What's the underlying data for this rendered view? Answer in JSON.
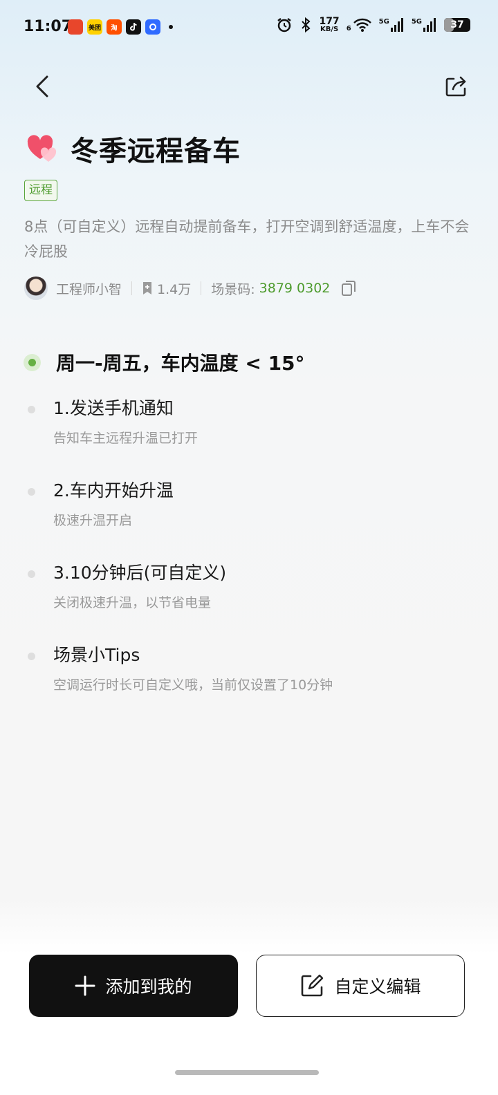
{
  "status_bar": {
    "time": "11:07",
    "app_icons": [
      {
        "name": "app-icon-1",
        "label": "",
        "color": "#e8462b"
      },
      {
        "name": "meituan-icon",
        "label": "美团",
        "color": "#ffd100"
      },
      {
        "name": "taobao-icon",
        "label": "淘",
        "color": "#ff5000"
      },
      {
        "name": "tiktok-icon",
        "label": "",
        "color": "#111111"
      },
      {
        "name": "app-icon-5",
        "label": "",
        "color": "#2f6bff"
      }
    ],
    "net_speed_value": "177",
    "net_speed_unit": "KB/S",
    "signal_1": "5G",
    "signal_2": "5G",
    "wifi_sub": "6",
    "battery": "37",
    "battery_level": 0.37
  },
  "header": {
    "title": "冬季远程备车",
    "tag": "远程",
    "description": "8点（可自定义）远程自动提前备车，打开空调到舒适温度，上车不会冷屁股",
    "author": "工程师小智",
    "saves": "1.4万",
    "code_label": "场景码:",
    "code_value": "3879 0302"
  },
  "trigger": {
    "text": "周一-周五，车内温度 < 15°"
  },
  "steps": [
    {
      "title": "1.发送手机通知",
      "subtitle": "告知车主远程升温已打开"
    },
    {
      "title": "2.车内开始升温",
      "subtitle": "极速升温开启"
    },
    {
      "title": "3.10分钟后(可自定义)",
      "subtitle": "关闭极速升温，以节省电量"
    },
    {
      "title": "场景小Tips",
      "subtitle": "空调运行时长可自定义哦，当前仅设置了10分钟"
    }
  ],
  "actions": {
    "add_label": "添加到我的",
    "edit_label": "自定义编辑"
  },
  "colors": {
    "accent_green": "#4d9b2d",
    "primary_button": "#111111"
  }
}
